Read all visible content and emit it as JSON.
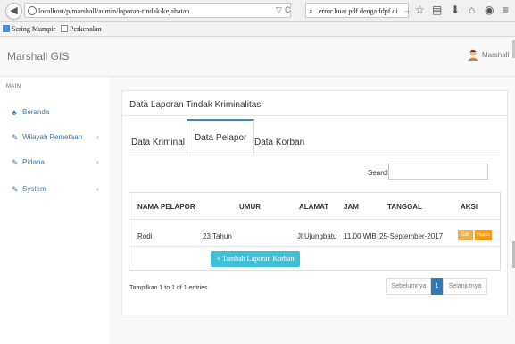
{
  "browser": {
    "url": "localhost/p/marshall/admin/laporan-tindak-kejahatan",
    "search_text": "error buat pdf denga fdpf di",
    "reload_glyph": "C",
    "dropdown_glyph": "▽",
    "search_go": "→"
  },
  "bookmarks": [
    {
      "label": "Sering Mumpir",
      "icon": "bookmark-folder-icon"
    },
    {
      "label": "Perkenalan",
      "icon": "page-icon"
    }
  ],
  "app": {
    "brand": "Marshall GIS",
    "user": "Marshall"
  },
  "sidebar": {
    "heading": "MAIN",
    "items": [
      {
        "label": "Beranda",
        "icon": "dashboard-icon",
        "has_children": false
      },
      {
        "label": "Wilayah Pemetaan",
        "icon": "edit-icon",
        "has_children": true
      },
      {
        "label": "Pidana",
        "icon": "edit-icon",
        "has_children": true
      },
      {
        "label": "System",
        "icon": "edit-icon",
        "has_children": true
      }
    ],
    "chevron": "‹"
  },
  "panel": {
    "title": "Data Laporan Tindak Kriminalitas",
    "tabs": [
      "Data Kriminal",
      "Data Pelapor",
      "Data Korban"
    ],
    "active_tab": 1,
    "search_label": "Search:",
    "columns": [
      "NAMA PELAPOR",
      "UMUR",
      "ALAMAT",
      "JAM",
      "TANGGAL",
      "AKSI"
    ],
    "rows": [
      {
        "nama": "Rodi",
        "umur": "23 Tahun",
        "alamat": "Jl.Ujungbatu",
        "jam": "11.00 WIB",
        "tanggal": "25-September-2017",
        "edit": "Edit",
        "hapus": "Hapus"
      }
    ],
    "add_button": "+ Tambah Laporan Korban",
    "info": "Tampilkan 1 to 1 of 1 entries",
    "pagination": {
      "prev": "Sebelumnya",
      "current": "1",
      "next": "Selanjutnya"
    }
  },
  "colors": {
    "primary": "#337ab7",
    "info": "#3fbfd8",
    "warning": "#f0ad4e"
  }
}
